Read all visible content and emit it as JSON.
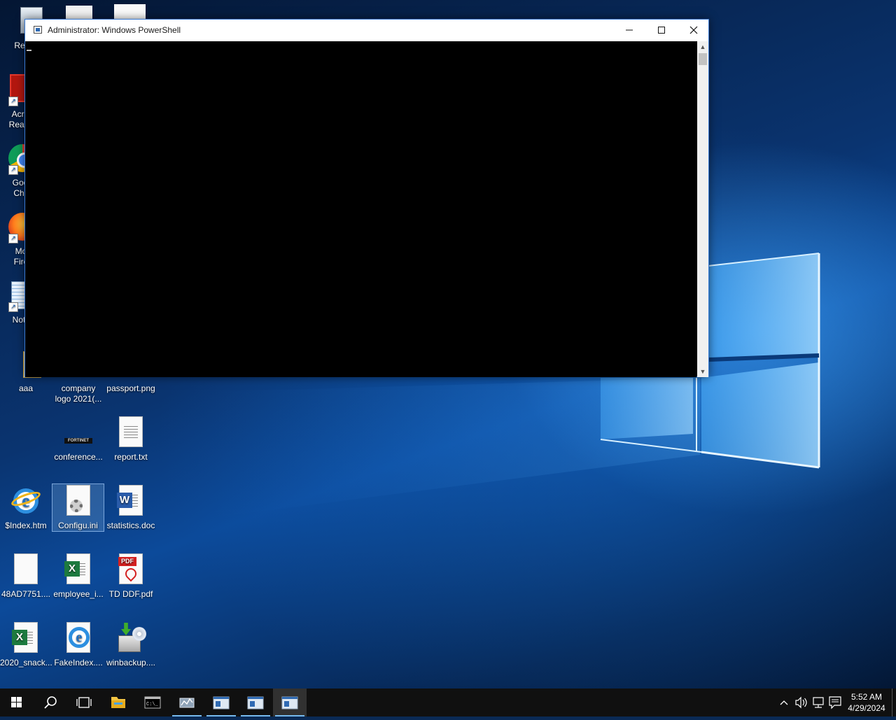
{
  "window": {
    "title": "Administrator: Windows PowerShell",
    "minimize_icon": "minimize-icon",
    "maximize_icon": "maximize-icon",
    "close_icon": "close-icon"
  },
  "console": {
    "text": ""
  },
  "desktop": {
    "partial_labels": {
      "recycle": "Recyc",
      "acrobat_line1": "Acro",
      "acrobat_line2": "Read",
      "chrome_line1": "Goo",
      "chrome_line2": "Chr",
      "firefox_line1": "Mo",
      "firefox_line2": "Fire",
      "notepad": "Not"
    },
    "icons": {
      "aaa": "aaa",
      "company_logo": "company logo 2021(...",
      "passport": "passport.png",
      "conference": "conference...",
      "report": "report.txt",
      "index": "$Index.htm",
      "config": "Configu.ini",
      "statistics": "statistics.doc",
      "hash": "48AD7751....",
      "employee": "employee_i...",
      "tddf": "TD DDF.pdf",
      "snack": "2020_snack...",
      "fakeindex": "FakeIndex....",
      "winbackup": "winbackup...."
    },
    "fortinet_logo_text": "FORTINET",
    "pdf_badge": "PDF",
    "excel_badge": "X",
    "word_badge": "W"
  },
  "taskbar": {
    "items": [
      "start-icon",
      "search-icon",
      "task-view-icon",
      "file-explorer-icon",
      "cmd-icon",
      "server-manager-icon",
      "app-window-icon",
      "app-window-icon",
      "powershell-window-icon"
    ],
    "tray_icons": [
      "chevron-up-icon",
      "volume-icon",
      "network-icon",
      "action-center-icon"
    ],
    "time": "5:52 AM",
    "date": "4/29/2024"
  },
  "colors": {
    "taskbar": "#101010",
    "accent": "#76b9ed",
    "console_bg": "#000000",
    "window_border": "#3a7bd5"
  }
}
